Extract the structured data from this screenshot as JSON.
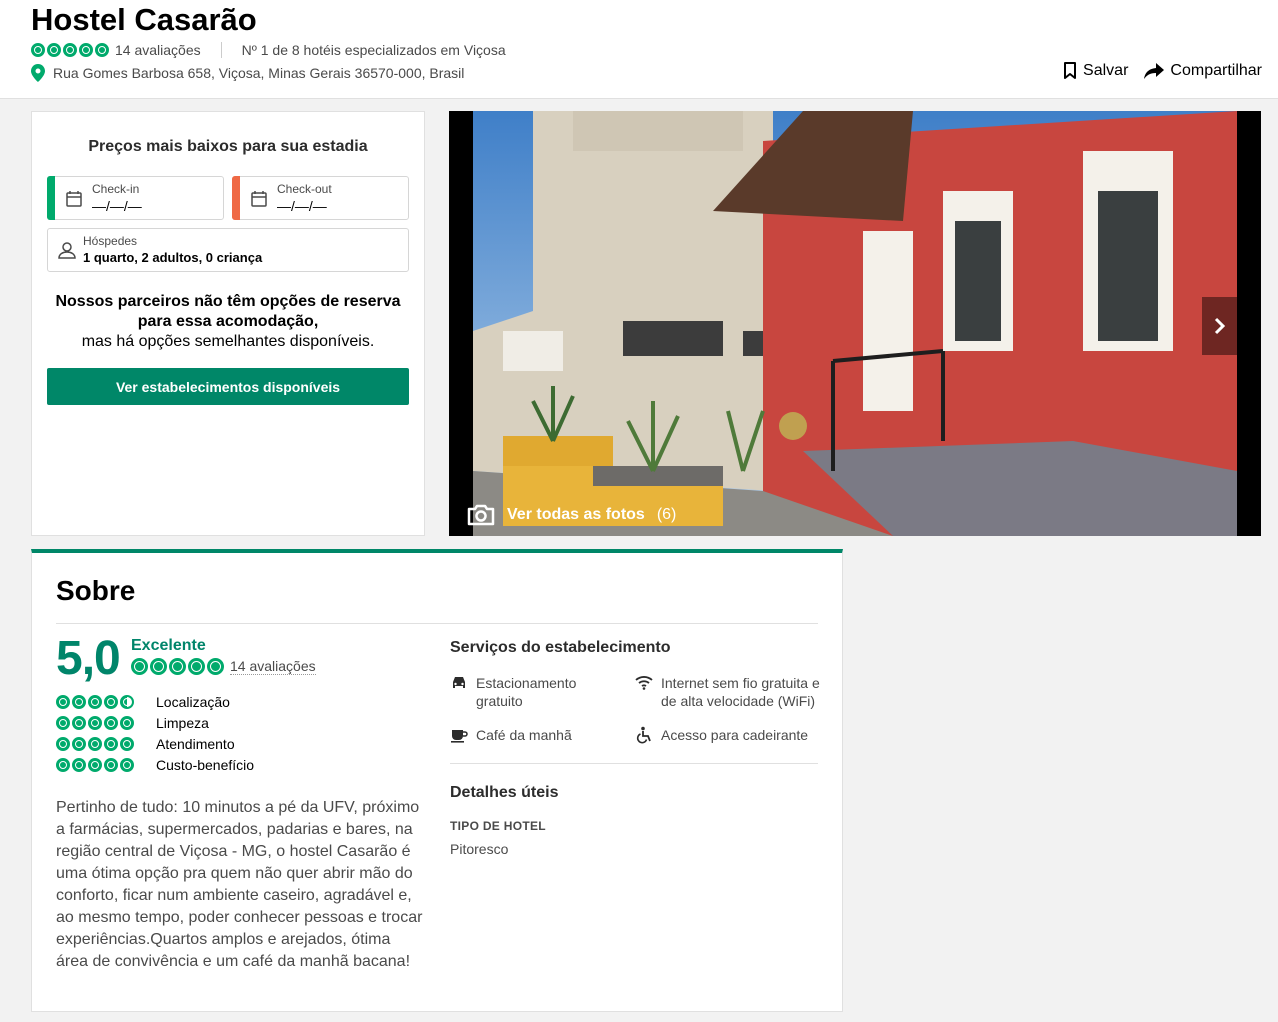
{
  "hotel": {
    "name": "Hostel Casarão",
    "rating_bubbles": 5,
    "reviews_count": "14 avaliações",
    "ranking": "Nº 1 de 8 hotéis especializados em Viçosa",
    "address": "Rua Gomes Barbosa 658, Viçosa, Minas Gerais 36570-000, Brasil"
  },
  "actions": {
    "save_label": "Salvar",
    "share_label": "Compartilhar"
  },
  "booking": {
    "title": "Preços mais baixos para sua estadia",
    "checkin_label": "Check-in",
    "checkin_value": "—/—/—",
    "checkout_label": "Check-out",
    "checkout_value": "—/—/—",
    "guests_label": "Hóspedes",
    "guests_value": "1 quarto, 2 adultos, 0 criança",
    "no_partner_bold": "Nossos parceiros não têm opções de reserva para essa acomodação,",
    "no_partner_rest": "mas há opções semelhantes disponíveis.",
    "button_label": "Ver estabelecimentos disponíveis",
    "colors": {
      "checkin_strip": "#00aa6c",
      "checkout_strip": "#ef6945",
      "button": "#008768"
    }
  },
  "photo": {
    "view_all_label": "Ver todas as fotos",
    "view_all_count": "(6)",
    "next_icon": "chevron-right-icon",
    "camera_icon": "camera-icon"
  },
  "about": {
    "title": "Sobre",
    "score": "5,0",
    "score_word": "Excelente",
    "reviews_count": "14 avaliações",
    "subratings": [
      {
        "label": "Localização",
        "bubbles": 4.5
      },
      {
        "label": "Limpeza",
        "bubbles": 5
      },
      {
        "label": "Atendimento",
        "bubbles": 5
      },
      {
        "label": "Custo-benefício",
        "bubbles": 5
      }
    ],
    "description": "Pertinho de tudo: 10 minutos a pé da UFV, próximo a farmácias, supermercados, padarias e bares, na região central de Viçosa - MG, o hostel Casarão é uma ótima opção pra quem não quer abrir mão do conforto, ficar num ambiente caseiro, agradável e, ao mesmo tempo, poder conhecer pessoas e trocar experiências.Quartos amplos e arejados, ótima área de convivência e um café da manhã bacana!",
    "services_title": "Serviços do estabelecimento",
    "services": [
      {
        "label": "Estacionamento gratuito",
        "icon": "car-icon"
      },
      {
        "label": "Internet sem fio gratuita e de alta velocidade (WiFi)",
        "icon": "wifi-icon"
      },
      {
        "label": "Café da manhã",
        "icon": "coffee-icon"
      },
      {
        "label": "Acesso para cadeirante",
        "icon": "wheelchair-icon"
      }
    ],
    "useful_title": "Detalhes úteis",
    "hotel_type_label": "TIPO DE HOTEL",
    "hotel_type_value": "Pitoresco"
  },
  "colors": {
    "brand_green": "#00aa6c",
    "dark_green": "#00856a"
  }
}
